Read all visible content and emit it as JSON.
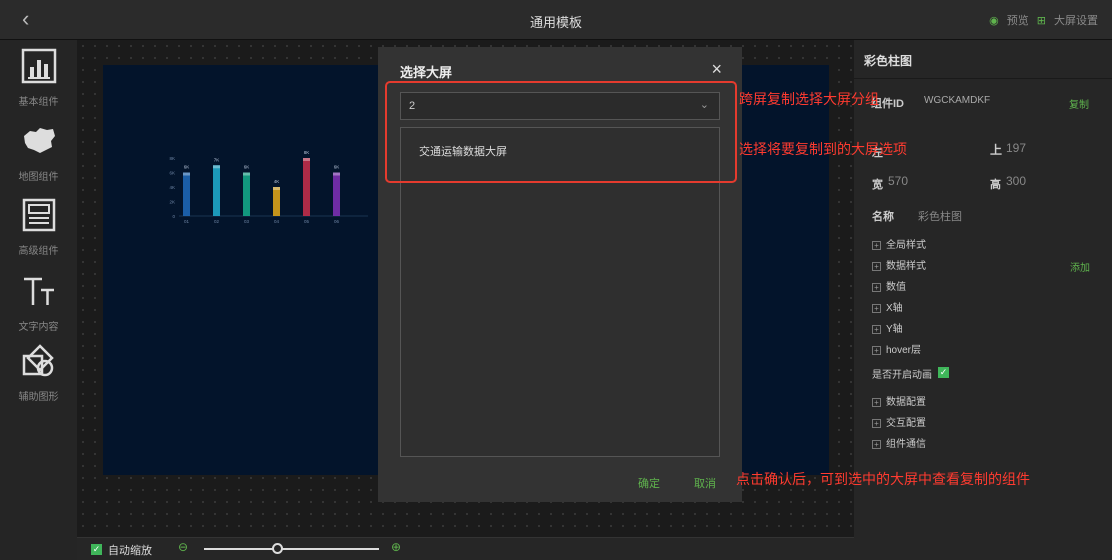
{
  "header": {
    "title": "通用模板",
    "back_icon": "chevron-left",
    "preview": "预览",
    "screen_settings": "大屏设置"
  },
  "left_panel": {
    "items": [
      {
        "label": "基本组件",
        "icon": "bar-chart-icon"
      },
      {
        "label": "地图组件",
        "icon": "map-icon"
      },
      {
        "label": "高级组件",
        "icon": "layout-icon"
      },
      {
        "label": "文字内容",
        "icon": "text-icon"
      },
      {
        "label": "辅助图形",
        "icon": "shapes-icon"
      }
    ]
  },
  "chart_data": {
    "type": "bar",
    "categories": [
      "01",
      "02",
      "03",
      "04",
      "05",
      "06"
    ],
    "values": [
      6000,
      7000,
      6000,
      4000,
      8000,
      6000
    ],
    "value_labels": [
      "6K",
      "7K",
      "6K",
      "4K",
      "8K",
      "6K"
    ],
    "y_ticks": [
      "8K",
      "6K",
      "4K",
      "2K",
      "0"
    ],
    "ylim": [
      0,
      8000
    ],
    "colors": [
      "#1e66b5",
      "#1fa7c9",
      "#14a687",
      "#d9a21a",
      "#c02d4a",
      "#7b2fb1"
    ]
  },
  "dialog": {
    "title": "选择大屏",
    "select_value": "2",
    "items": [
      "交通运输数据大屏"
    ],
    "confirm": "确定",
    "cancel": "取消"
  },
  "annotations": {
    "a1": "跨屏复制选择大屏分组",
    "a2": "选择将要复制到的大屏选项",
    "a3": "点击确认后，可到选中的大屏中查看复制的组件"
  },
  "right_panel": {
    "title": "彩色柱图",
    "component_id_label": "组件ID",
    "component_id": "WGCKAMDKF",
    "copy": "复制",
    "left_label": "左",
    "top_label": "上",
    "top_value": "197",
    "width_label": "宽",
    "width_value": "570",
    "height_label": "高",
    "height_value": "300",
    "name_label": "名称",
    "name_value": "彩色柱图",
    "sections": [
      "全局样式",
      "数据样式",
      "数值",
      "X轴",
      "Y轴",
      "hover层"
    ],
    "add": "添加",
    "anim_label": "是否开启动画",
    "sections2": [
      "数据配置",
      "交互配置",
      "组件通信"
    ]
  },
  "bottom": {
    "auto_zoom": "自动缩放",
    "slider_value": 0.42
  }
}
